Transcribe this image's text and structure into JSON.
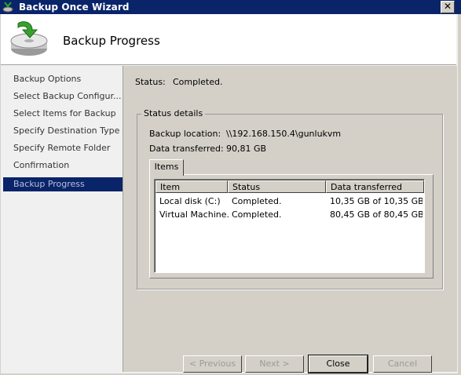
{
  "window": {
    "title": "Backup Once Wizard"
  },
  "header": {
    "title": "Backup Progress"
  },
  "nav": {
    "items": [
      {
        "label": "Backup Options"
      },
      {
        "label": "Select Backup Configur..."
      },
      {
        "label": "Select Items for Backup"
      },
      {
        "label": "Specify Destination Type"
      },
      {
        "label": "Specify Remote Folder"
      },
      {
        "label": "Confirmation"
      },
      {
        "label": "Backup Progress"
      }
    ]
  },
  "status": {
    "label": "Status:",
    "value": "Completed."
  },
  "details": {
    "legend": "Status details",
    "location_label": "Backup location:",
    "location_value": "\\\\192.168.150.4\\gunlukvm",
    "transferred_label": "Data transferred:",
    "transferred_value": "90,81 GB"
  },
  "tabs": {
    "items_label": "Items"
  },
  "list": {
    "columns": [
      "Item",
      "Status",
      "Data transferred"
    ],
    "rows": [
      {
        "item": "Local disk (C:)",
        "status": "Completed.",
        "data": "10,35 GB of 10,35 GB"
      },
      {
        "item": "Virtual Machine...",
        "status": "Completed.",
        "data": "80,45 GB of 80,45 GB"
      }
    ]
  },
  "buttons": {
    "previous": "< Previous",
    "next": "Next >",
    "close": "Close",
    "cancel": "Cancel"
  },
  "colors": {
    "titlebar": "#0a246a",
    "nav_active": "#0a246a",
    "face": "#d4d0c8"
  },
  "icons": {
    "window": "backup-app-icon",
    "header": "backup-disk-icon"
  }
}
